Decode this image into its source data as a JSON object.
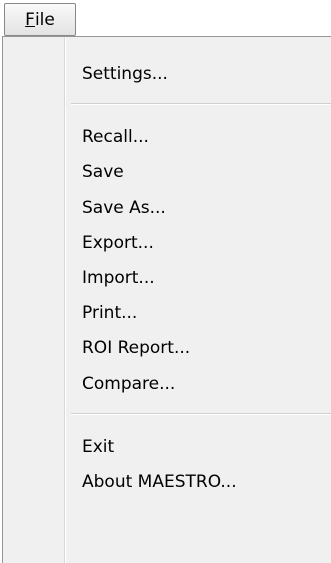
{
  "menubar": {
    "file_mnemonic": "F",
    "file_rest": "ile"
  },
  "menu": {
    "items": [
      {
        "label": "Settings..."
      },
      {
        "label": "Recall..."
      },
      {
        "label": "Save"
      },
      {
        "label": "Save As..."
      },
      {
        "label": "Export..."
      },
      {
        "label": "Import..."
      },
      {
        "label": "Print..."
      },
      {
        "label": "ROI Report..."
      },
      {
        "label": "Compare..."
      },
      {
        "label": "Exit"
      },
      {
        "label": "About MAESTRO..."
      }
    ]
  }
}
